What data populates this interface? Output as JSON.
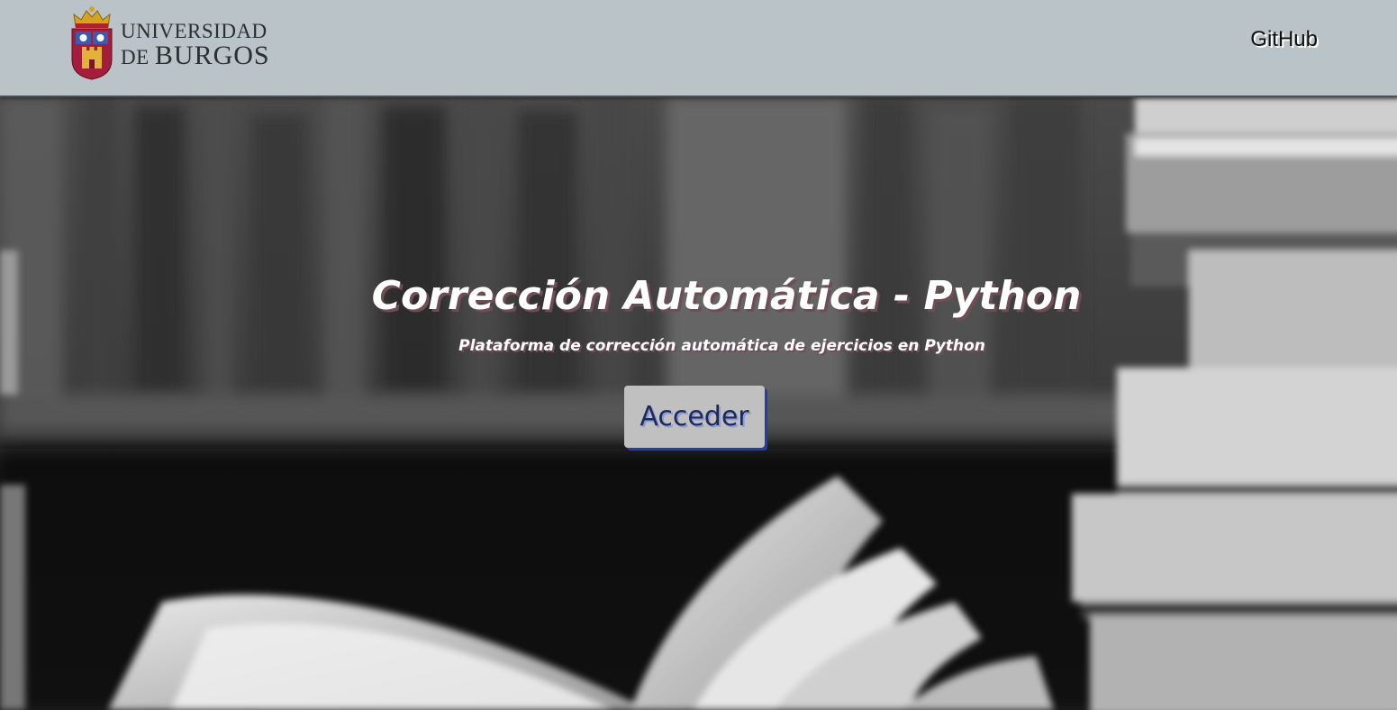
{
  "header": {
    "logo": {
      "line1": "UNIVERSIDAD",
      "line2_prefix": "DE",
      "line2_main": "BURGOS",
      "crest_icon": "university-crest-icon"
    },
    "github_label": "GitHub",
    "background_color": "#b9c3c8"
  },
  "hero": {
    "title": "Corrección Automática - Python",
    "subtitle": "Plataforma de corrección automática de ejercicios en Python",
    "button_label": "Acceder",
    "background": "blurred-bookshelf-photo",
    "button_color": "#c0c0c0",
    "accent_color": "#1f3fb0"
  }
}
